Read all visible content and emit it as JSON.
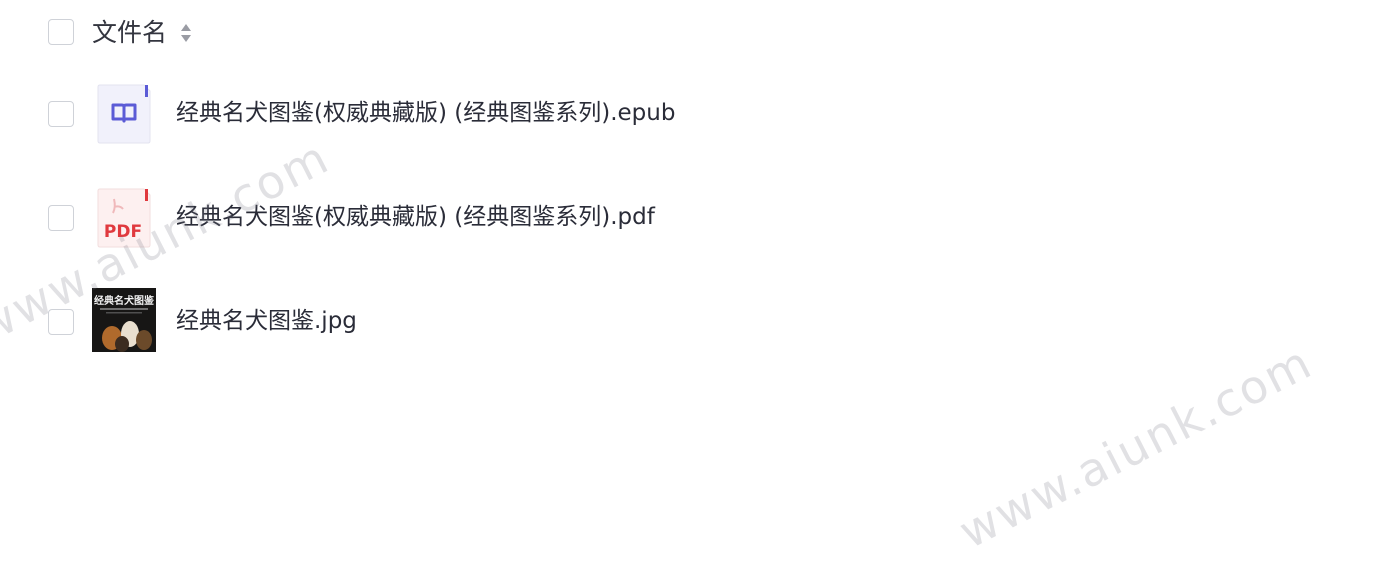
{
  "header": {
    "label": "文件名"
  },
  "files": [
    {
      "name": "经典名犬图鉴(权威典藏版) (经典图鉴系列).epub",
      "type": "epub"
    },
    {
      "name": "经典名犬图鉴(权威典藏版) (经典图鉴系列).pdf",
      "type": "pdf",
      "icon_text": "PDF"
    },
    {
      "name": "经典名犬图鉴.jpg",
      "type": "jpg",
      "thumb_title": "经典名犬图鉴"
    }
  ],
  "watermarks": [
    "www.aiunk.com",
    "www.aiunk.com"
  ],
  "colors": {
    "epub_accent": "#5b5bd6",
    "pdf_accent": "#e0393e",
    "checkbox_border": "#cfd2d8"
  }
}
